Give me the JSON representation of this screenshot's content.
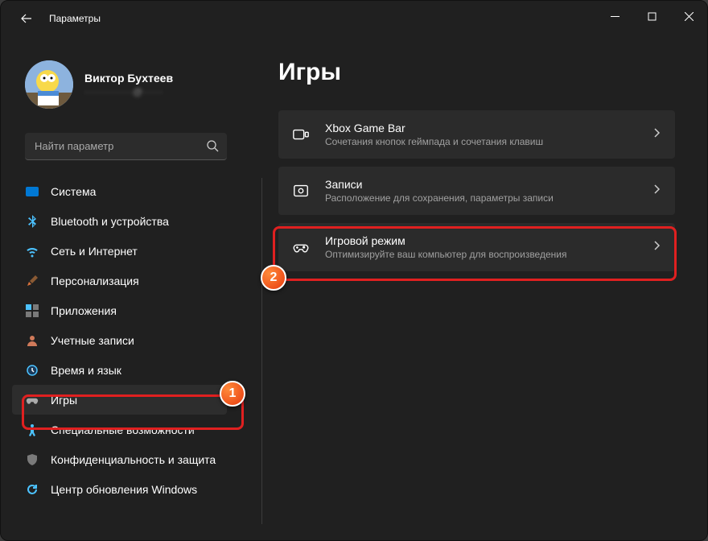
{
  "window": {
    "title": "Параметры"
  },
  "profile": {
    "name": "Виктор Бухтеев",
    "email": "············@·····"
  },
  "search": {
    "placeholder": "Найти параметр"
  },
  "sidebar": {
    "items": [
      {
        "label": "Система"
      },
      {
        "label": "Bluetooth и устройства"
      },
      {
        "label": "Сеть и Интернет"
      },
      {
        "label": "Персонализация"
      },
      {
        "label": "Приложения"
      },
      {
        "label": "Учетные записи"
      },
      {
        "label": "Время и язык"
      },
      {
        "label": "Игры"
      },
      {
        "label": "Специальные возможности"
      },
      {
        "label": "Конфиденциальность и защита"
      },
      {
        "label": "Центр обновления Windows"
      }
    ]
  },
  "page": {
    "title": "Игры",
    "items": [
      {
        "title": "Xbox Game Bar",
        "subtitle": "Сочетания кнопок геймпада и сочетания клавиш"
      },
      {
        "title": "Записи",
        "subtitle": "Расположение для сохранения, параметры записи"
      },
      {
        "title": "Игровой режим",
        "subtitle": "Оптимизируйте ваш компьютер для воспроизведения"
      }
    ]
  },
  "annotations": {
    "step1": "1",
    "step2": "2"
  }
}
